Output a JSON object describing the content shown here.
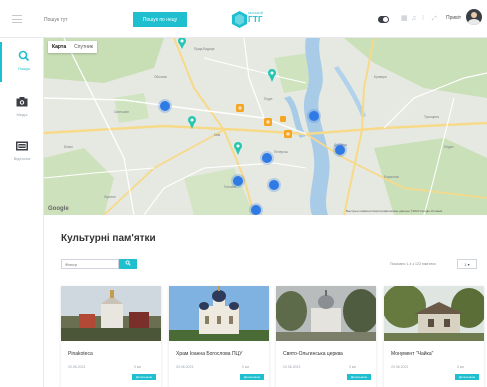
{
  "header": {
    "search_placeholder": "Пошук тут",
    "search_button": "Пошук по нецу",
    "logo_sub": "МИСЬКИЙ",
    "logo_text": "ГТГ",
    "toggle_label": "",
    "greeting": "Привіт"
  },
  "sidebar": {
    "items": [
      {
        "label": "Пошук",
        "icon": "search-icon"
      },
      {
        "label": "Медіа",
        "icon": "camera-icon"
      },
      {
        "label": "Відеосна",
        "icon": "video-icon"
      }
    ]
  },
  "map": {
    "tabs": [
      "Карта",
      "Спутник"
    ],
    "active_tab": "Карта",
    "google_label": "Google",
    "attribution": "Быстрые клавиши   Картографические данные ©2023 Google   Условия"
  },
  "content": {
    "heading": "Культурні пам'ятки",
    "filter_placeholder": "Фільтр",
    "pager_text": "Показано 1-4 з 123 пам'яток",
    "pager_select": "1 ▾",
    "cards": [
      {
        "title": "Pinakoteca",
        "date": "20.06.2021",
        "distance": "0 км",
        "button": "Детальніше"
      },
      {
        "title": "Храм Іоанна Богослова ПЦУ",
        "date": "20.06.2021",
        "distance": "0 км",
        "button": "Детальніше"
      },
      {
        "title": "Свято-Ольгинська церква",
        "date": "20.06.2021",
        "distance": "0 км",
        "button": "Детальніше"
      },
      {
        "title": "Монумент \"Чайка\"",
        "date": "20.06.2021",
        "distance": "0 км",
        "button": "Детальніше"
      }
    ]
  },
  "colors": {
    "accent": "#1fbfcf",
    "marker_blue": "#2f7ae5",
    "marker_orange": "#f4a521",
    "marker_teal": "#26c6b0"
  }
}
